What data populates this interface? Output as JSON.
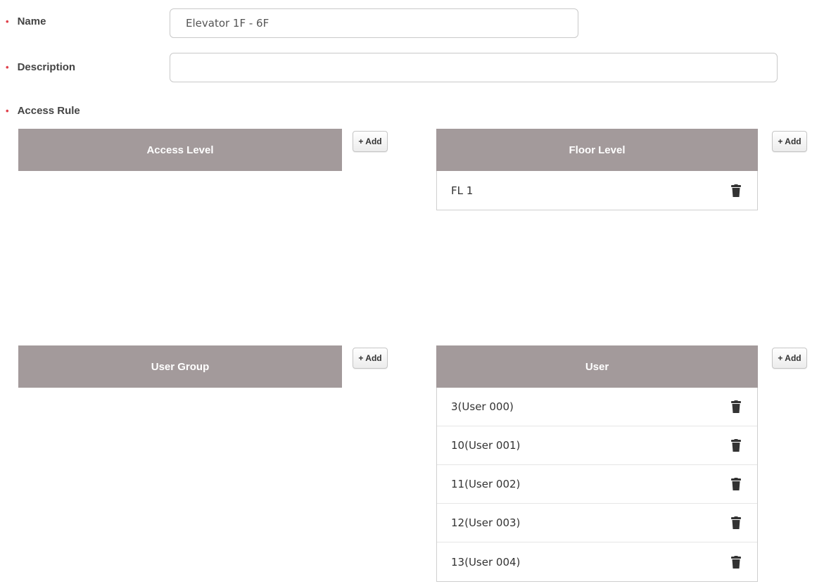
{
  "form": {
    "name": {
      "label": "Name",
      "value": "Elevator 1F - 6F"
    },
    "description": {
      "label": "Description",
      "value": ""
    },
    "access_rule": {
      "label": "Access Rule"
    }
  },
  "add_label": "+ Add",
  "panels": {
    "access_level": {
      "title": "Access Level",
      "items": []
    },
    "floor_level": {
      "title": "Floor Level",
      "items": [
        "FL 1"
      ]
    },
    "user_group": {
      "title": "User Group",
      "items": []
    },
    "user": {
      "title": "User",
      "items": [
        "3(User 000)",
        "10(User 001)",
        "11(User 002)",
        "12(User 003)",
        "13(User 004)"
      ]
    }
  },
  "colors": {
    "header_bg": "#a39a9b",
    "required_bullet": "#e0404a"
  },
  "icons": {
    "delete": "trash-icon"
  }
}
